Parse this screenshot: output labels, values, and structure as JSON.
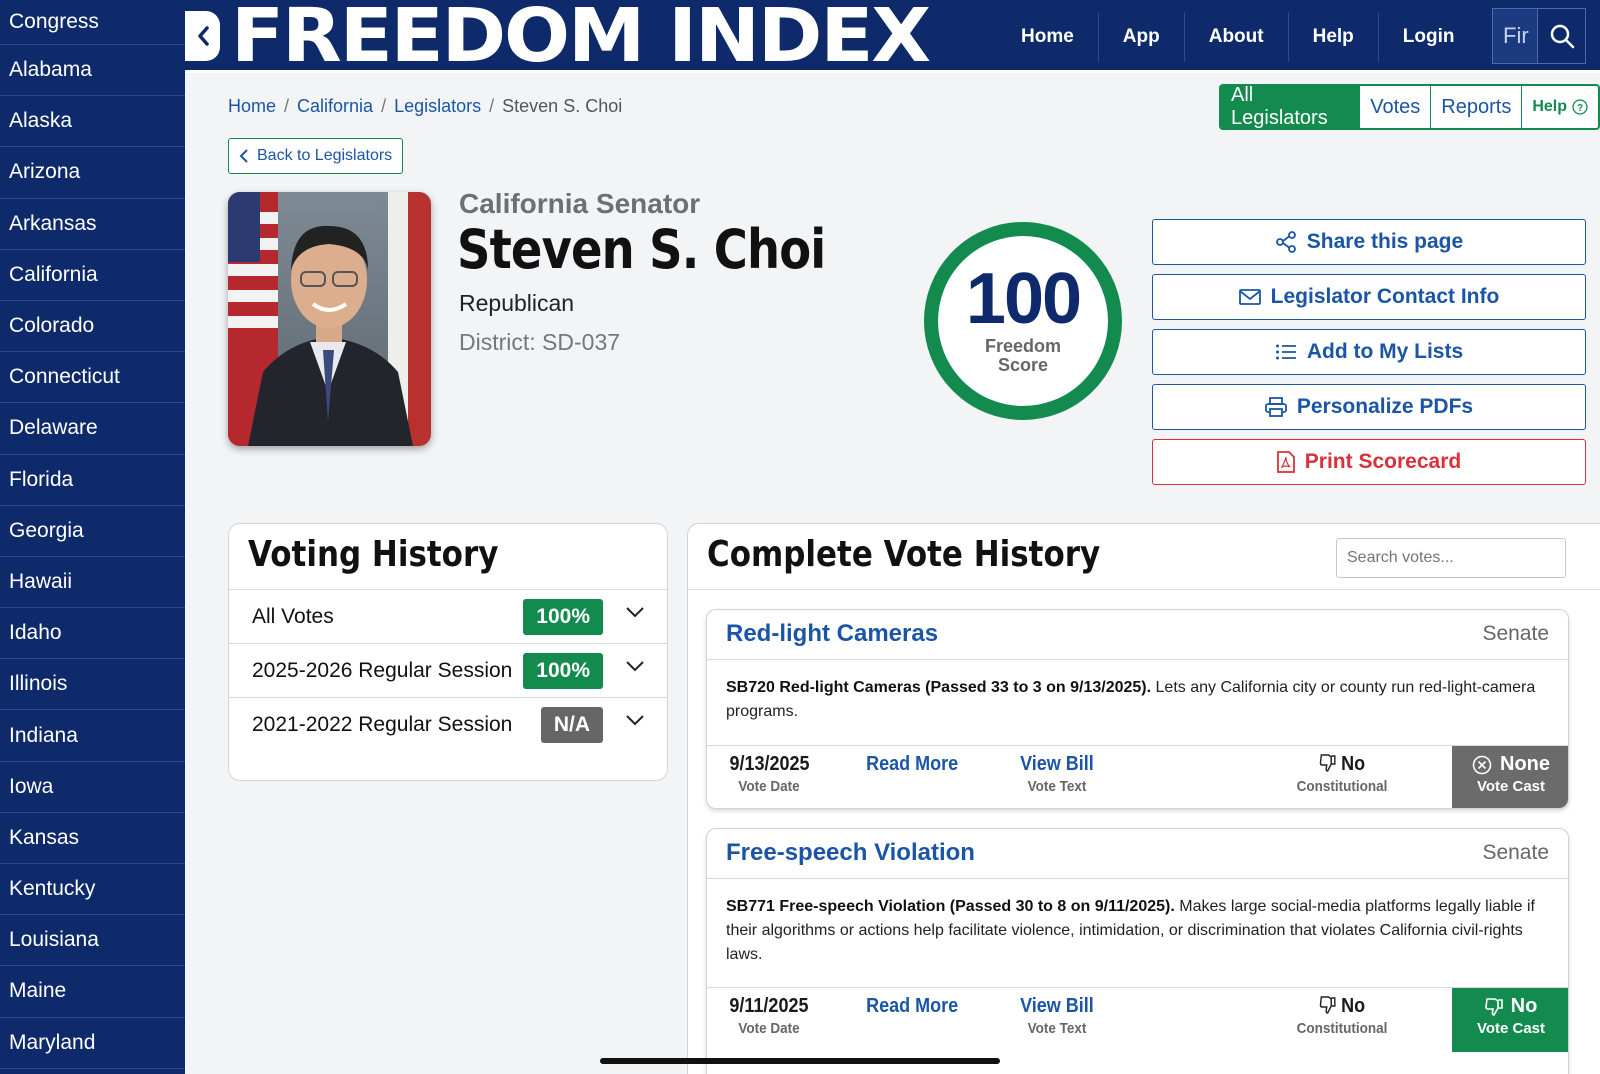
{
  "sidebar": {
    "items": [
      "Congress",
      "Alabama",
      "Alaska",
      "Arizona",
      "Arkansas",
      "California",
      "Colorado",
      "Connecticut",
      "Delaware",
      "Florida",
      "Georgia",
      "Hawaii",
      "Idaho",
      "Illinois",
      "Indiana",
      "Iowa",
      "Kansas",
      "Kentucky",
      "Louisiana",
      "Maine",
      "Maryland"
    ]
  },
  "header": {
    "logo": "FREEDOM INDEX",
    "nav": [
      "Home",
      "App",
      "About",
      "Help",
      "Login"
    ],
    "search_value": "Fir"
  },
  "breadcrumb": [
    "Home",
    "California",
    "Legislators",
    "Steven S. Choi"
  ],
  "tabs": {
    "all_legislators": "All Legislators",
    "votes": "Votes",
    "reports": "Reports",
    "help": "Help"
  },
  "back_label": "Back to Legislators",
  "profile": {
    "role": "California Senator",
    "name": "Steven S. Choi",
    "party": "Republican",
    "district": "District: SD-037"
  },
  "score": {
    "value": "100",
    "label_line1": "Freedom",
    "label_line2": "Score",
    "fraction": 1.0
  },
  "actions": {
    "share": "Share this page",
    "contact": "Legislator Contact Info",
    "lists": "Add to My Lists",
    "pdfs": "Personalize PDFs",
    "print": "Print Scorecard"
  },
  "voting_history": {
    "title": "Voting History",
    "rows": [
      {
        "label": "All Votes",
        "score": "100%"
      },
      {
        "label": "2025-2026 Regular Session",
        "score": "100%"
      },
      {
        "label": "2021-2022 Regular Session",
        "score": "N/A"
      }
    ]
  },
  "complete_history": {
    "title": "Complete Vote History",
    "search_placeholder": "Search votes...",
    "votes": [
      {
        "title": "Red-light Cameras",
        "chamber": "Senate",
        "desc_bold": "SB720 Red-light Cameras (Passed 33 to 3 on 9/13/2025).",
        "desc_rest": " Lets any California city or county run red-light-camera programs.",
        "date": "9/13/2025",
        "date_label": "Vote Date",
        "read_more": "Read More",
        "view_bill": "View Bill",
        "vote_text": "Vote Text",
        "constitutional": "No",
        "constitutional_label": "Constitutional",
        "cast": "None",
        "cast_label": "Vote Cast"
      },
      {
        "title": "Free-speech Violation",
        "chamber": "Senate",
        "desc_bold": "SB771 Free-speech Violation (Passed 30 to 8 on 9/11/2025).",
        "desc_rest": " Makes large social-media platforms legally liable if their algorithms or actions help facilitate violence, intimidation, or discrimination that violates California civil-rights laws.",
        "date": "9/11/2025",
        "date_label": "Vote Date",
        "read_more": "Read More",
        "view_bill": "View Bill",
        "vote_text": "Vote Text",
        "constitutional": "No",
        "constitutional_label": "Constitutional",
        "cast": "No",
        "cast_label": "Vote Cast"
      }
    ]
  },
  "colors": {
    "navy": "#0e2a6b",
    "green": "#138a4e",
    "link_blue": "#1b55a6",
    "red": "#d9303a"
  }
}
